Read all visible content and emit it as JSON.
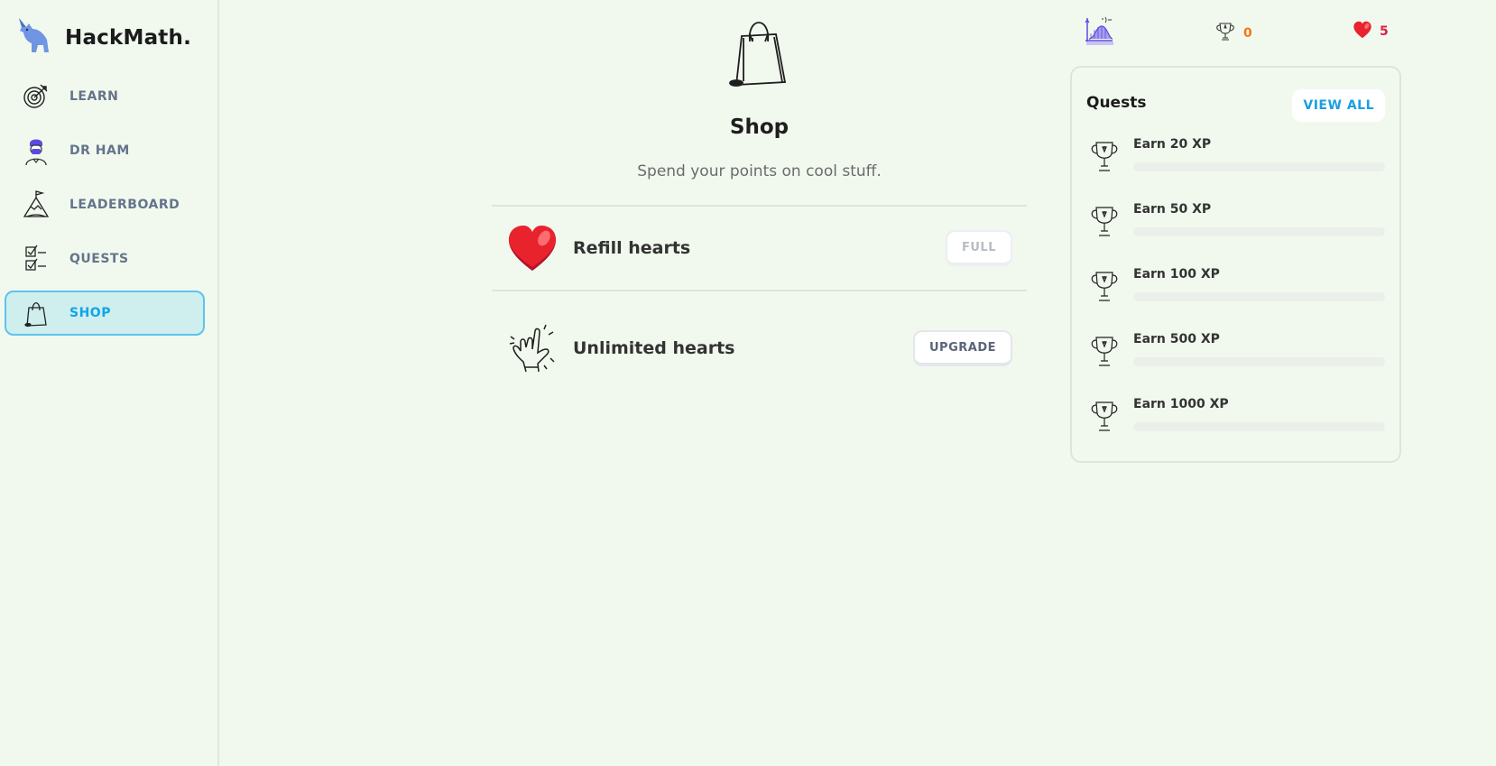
{
  "brand": {
    "name": "HackMath."
  },
  "sidebar": {
    "items": [
      {
        "label": "LEARN",
        "icon": "target-icon",
        "active": false
      },
      {
        "label": "DR HAM",
        "icon": "doctor-avatar-icon",
        "active": false
      },
      {
        "label": "LEADERBOARD",
        "icon": "mountain-flag-icon",
        "active": false
      },
      {
        "label": "QUESTS",
        "icon": "checklist-icon",
        "active": false
      },
      {
        "label": "SHOP",
        "icon": "shopping-bag-icon",
        "active": true
      }
    ]
  },
  "header_stats": {
    "course_icon": "function-graph-icon",
    "points": "0",
    "hearts": "5",
    "points_color": "#f97316",
    "hearts_color": "#e11d48"
  },
  "main": {
    "hero_icon": "shopping-bag-icon",
    "title": "Shop",
    "subtitle": "Spend your points on cool stuff.",
    "items": [
      {
        "name": "Refill hearts",
        "icon": "heart-icon",
        "button": "FULL",
        "disabled": true
      },
      {
        "name": "Unlimited hearts",
        "icon": "rock-hand-icon",
        "button": "UPGRADE",
        "disabled": false
      }
    ]
  },
  "quests": {
    "title": "Quests",
    "view_all": "VIEW ALL",
    "items": [
      {
        "label": "Earn 20 XP",
        "progress": 0
      },
      {
        "label": "Earn 50 XP",
        "progress": 0
      },
      {
        "label": "Earn 100 XP",
        "progress": 0
      },
      {
        "label": "Earn 500 XP",
        "progress": 0
      },
      {
        "label": "Earn 1000 XP",
        "progress": 0
      }
    ]
  },
  "colors": {
    "accent": "#0ea5e9",
    "active_bg": "#cfeeee",
    "background": "#f1f9ee"
  }
}
